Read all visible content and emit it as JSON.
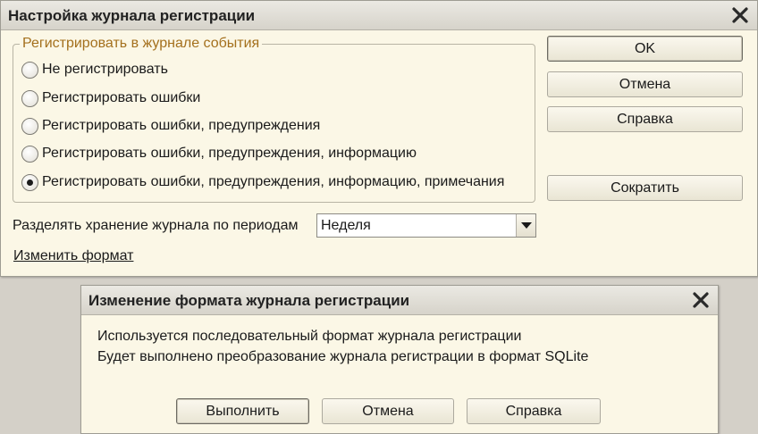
{
  "main_dialog": {
    "title": "Настройка журнала регистрации",
    "group_title": "Регистрировать в журнале события",
    "options": [
      {
        "label": "Не регистрировать",
        "selected": false
      },
      {
        "label": "Регистрировать ошибки",
        "selected": false
      },
      {
        "label": "Регистрировать ошибки, предупреждения",
        "selected": false
      },
      {
        "label": "Регистрировать ошибки, предупреждения, информацию",
        "selected": false
      },
      {
        "label": "Регистрировать ошибки, предупреждения, информацию, примечания",
        "selected": true
      }
    ],
    "period_label": "Разделять хранение журнала по периодам",
    "period_value": "Неделя",
    "change_format_link": "Изменить формат",
    "buttons": {
      "ok": "OK",
      "cancel": "Отмена",
      "help": "Справка",
      "shrink": "Сократить"
    }
  },
  "format_dialog": {
    "title": "Изменение формата журнала регистрации",
    "message_line1": "Используется последовательный формат журнала регистрации",
    "message_line2": "Будет выполнено преобразование журнала регистрации в формат SQLite",
    "buttons": {
      "execute": "Выполнить",
      "cancel": "Отмена",
      "help": "Справка"
    }
  },
  "colors": {
    "dialog_bg": "#fbf7e6",
    "desktop_bg": "#d4d0c8",
    "group_title": "#a4701d"
  },
  "icons": {
    "close": "close-icon",
    "dropdown": "dropdown-arrow-icon"
  }
}
